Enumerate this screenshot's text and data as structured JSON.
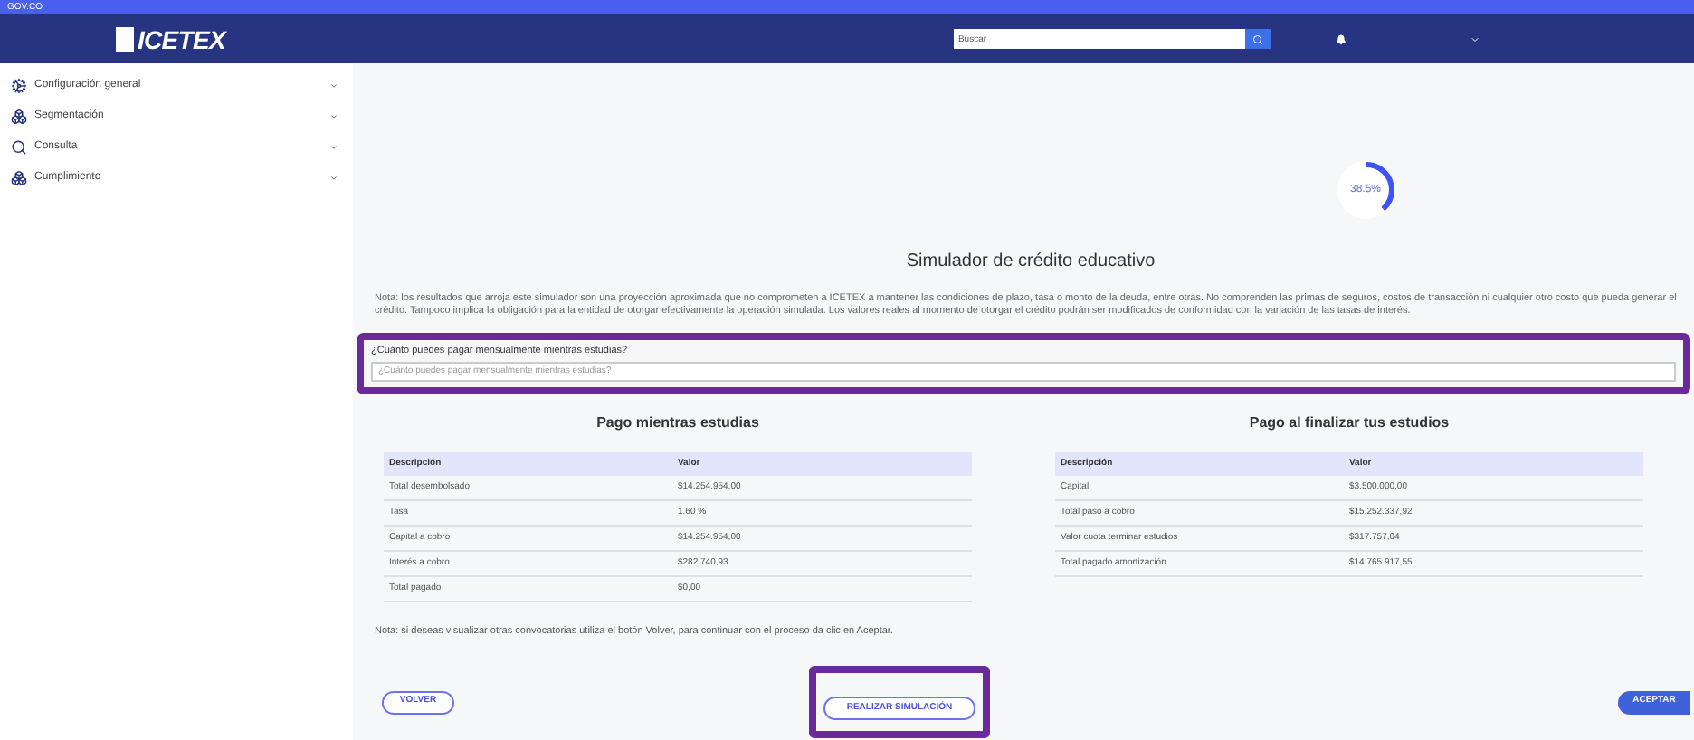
{
  "gov_bar": {
    "label": "GOV.CO"
  },
  "header": {
    "logo": "ICETEX",
    "search": {
      "placeholder": "Buscar"
    }
  },
  "sidebar": {
    "items": [
      {
        "label": "Configuración general",
        "kind": "gears"
      },
      {
        "label": "Segmentación",
        "kind": "cubes"
      },
      {
        "label": "Consulta",
        "kind": "search"
      },
      {
        "label": "Cumplimiento",
        "kind": "cubes"
      }
    ]
  },
  "progress": {
    "level": 0.385,
    "reading": "38.5%"
  },
  "title": "Simulador de crédito educativo",
  "note": "Nota: los resultados que arroja este simulador son una proyección aproximada que no comprometen a ICETEX a mantener las condiciones de plazo, tasa o monto de la deuda, entre otras. No comprenden las primas de seguros, costos de transacción ni cualquier otro costo que pueda generar el crédito. Tampoco implica la obligación para la entidad de otorgar efectivamente la operación simulada. Los valores reales al momento de otorgar el crédito podrán ser modificados de conformidad con la variación de las tasas de interés.",
  "monthly_field": {
    "label": "¿Cuánto puedes pagar mensualmente mientras estudias?",
    "placeholder": "¿Cuánto puedes pagar mensualmente mientras estudias?"
  },
  "tables": [
    {
      "title": "Pago mientras estudias",
      "columns": [
        "Descripción",
        "Valor"
      ],
      "rows": [
        [
          "Total desembolsado",
          "$14.254.954,00"
        ],
        [
          "Tasa",
          "1.60 %"
        ],
        [
          "Capital a cobro",
          "$14.254.954,00"
        ],
        [
          "Interés a cobro",
          "$282.740,93"
        ],
        [
          "Total pagado",
          "$0,00"
        ]
      ]
    },
    {
      "title": "Pago al finalizar tus estudios",
      "columns": [
        "Descripción",
        "Valor"
      ],
      "rows": [
        [
          "Capital",
          "$3.500.000,00"
        ],
        [
          "Total paso a cobro",
          "$15.252.337,92"
        ],
        [
          "Valor cuota terminar estudios",
          "$317.757,04"
        ],
        [
          "Total pagado amortización",
          "$14.765.917,55"
        ]
      ]
    }
  ],
  "footer_note": "Nota: si deseas visualizar otras convocatorias utiliza el botón Volver, para continuar con el proceso da clic en Aceptar.",
  "buttons": {
    "back": "VOLVER",
    "simulate": "REALIZAR SIMULACIÓN",
    "accept": "ACEPTAR"
  }
}
